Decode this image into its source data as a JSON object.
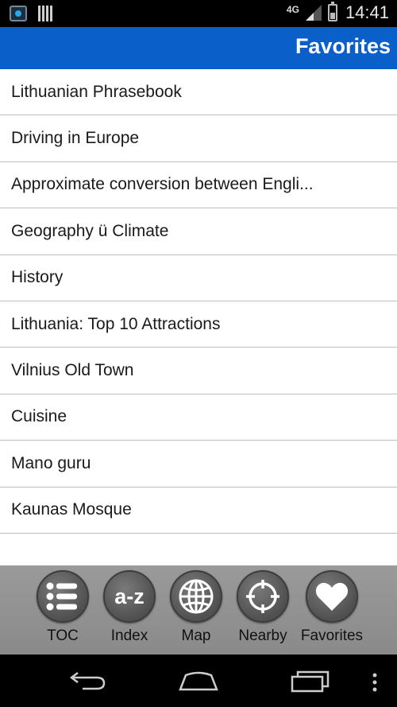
{
  "status_bar": {
    "network": "4G",
    "time": "14:41"
  },
  "header": {
    "title": "Favorites"
  },
  "favorites": [
    "Lithuanian Phrasebook",
    "Driving in Europe",
    "Approximate conversion between Engli...",
    "Geography ü Climate",
    "History",
    "Lithuania: Top 10 Attractions",
    "Vilnius Old Town",
    "Cuisine",
    "Mano guru",
    "Kaunas Mosque"
  ],
  "toolbar": {
    "toc_label": "TOC",
    "index_label": "Index",
    "index_icon_text": "a-z",
    "map_label": "Map",
    "nearby_label": "Nearby",
    "favorites_label": "Favorites"
  },
  "colors": {
    "title_bar": "#0a5fc8",
    "toolbar": "#909090",
    "status_bar": "#000000"
  },
  "icons": [
    "app-icon",
    "barcode-icon",
    "signal-icon",
    "battery-icon",
    "list-icon",
    "globe-icon",
    "crosshair-icon",
    "heart-icon",
    "back-icon",
    "home-icon",
    "recent-apps-icon",
    "overflow-menu-icon"
  ]
}
